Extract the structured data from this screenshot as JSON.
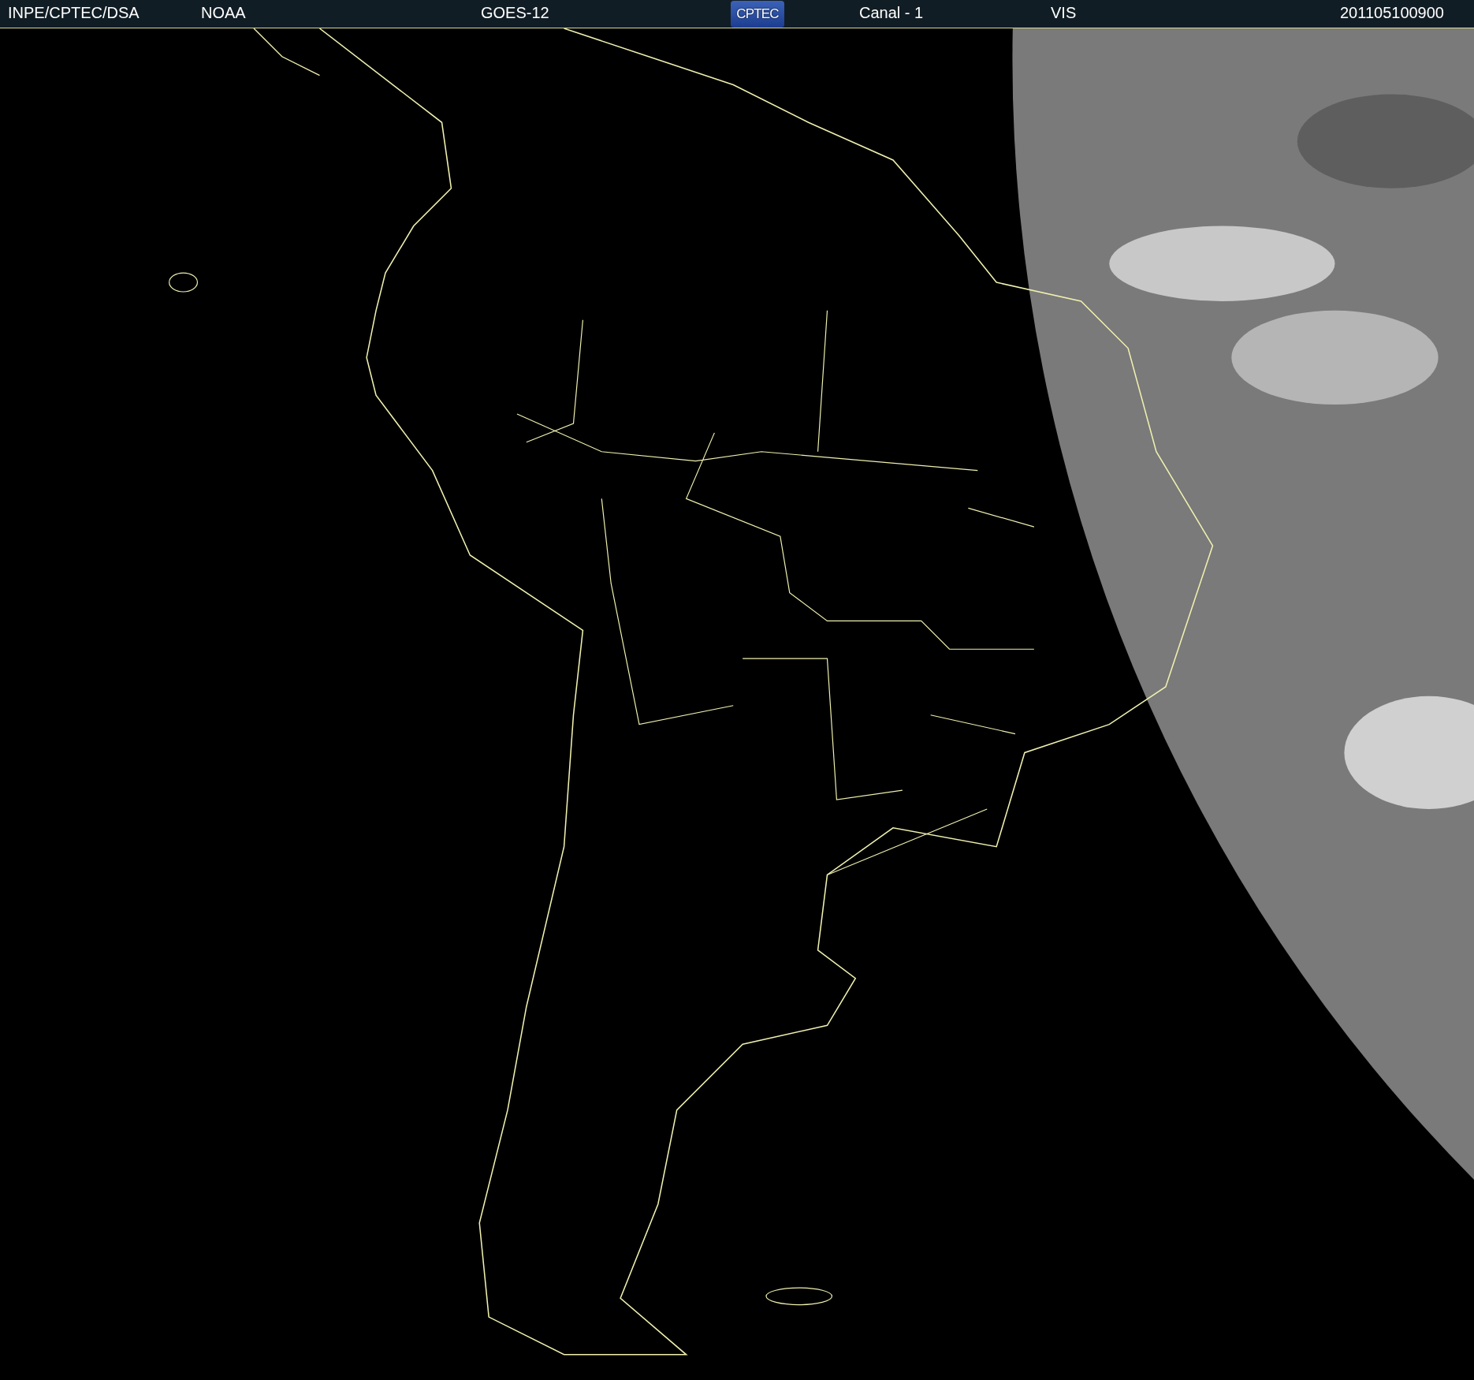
{
  "header": {
    "items": [
      {
        "kind": "text",
        "text": "INPE/CPTEC/DSA"
      },
      {
        "kind": "text",
        "text": "NOAA"
      },
      {
        "kind": "text",
        "text": "GOES-12"
      },
      {
        "kind": "logo",
        "text": "CPTEC"
      },
      {
        "kind": "text",
        "text": "Canal - 1"
      },
      {
        "kind": "text",
        "text": "VIS"
      },
      {
        "kind": "text",
        "text": "201105100900"
      }
    ]
  }
}
